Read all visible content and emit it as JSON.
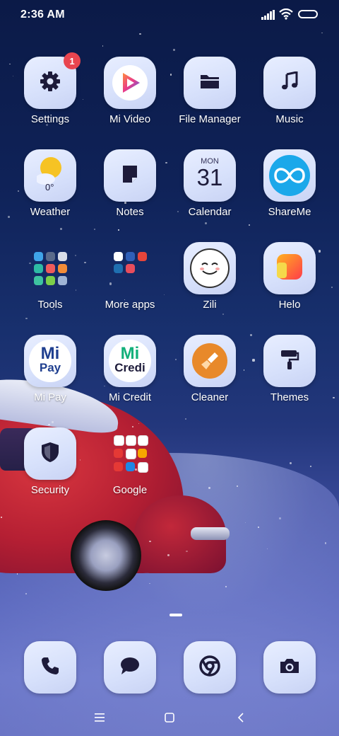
{
  "status_bar": {
    "time": "2:36 AM"
  },
  "apps": [
    {
      "label": "Settings",
      "icon": "gear-icon",
      "badge": "1"
    },
    {
      "label": "Mi Video",
      "icon": "play-icon"
    },
    {
      "label": "File Manager",
      "icon": "folder-icon"
    },
    {
      "label": "Music",
      "icon": "music-note-icon"
    },
    {
      "label": "Weather",
      "icon": "weather-icon",
      "temp": "0°"
    },
    {
      "label": "Notes",
      "icon": "note-icon"
    },
    {
      "label": "Calendar",
      "icon": "calendar-icon",
      "day_name": "MON",
      "day_number": "31"
    },
    {
      "label": "ShareMe",
      "icon": "shareme-icon"
    },
    {
      "label": "Tools",
      "icon": "folder-tools-icon"
    },
    {
      "label": "More apps",
      "icon": "folder-more-apps-icon"
    },
    {
      "label": "Zili",
      "icon": "zili-face-icon"
    },
    {
      "label": "Helo",
      "icon": "helo-icon"
    },
    {
      "label": "Mi Pay",
      "icon": "mi-pay-icon",
      "icon_text_1": "Mi",
      "icon_text_2": "Pay"
    },
    {
      "label": "Mi Credit",
      "icon": "mi-credit-icon",
      "icon_text_1": "Mi",
      "icon_text_2": "Credi"
    },
    {
      "label": "Cleaner",
      "icon": "broom-icon"
    },
    {
      "label": "Themes",
      "icon": "paint-roller-icon"
    },
    {
      "label": "Security",
      "icon": "shield-icon"
    },
    {
      "label": "Google",
      "icon": "folder-google-icon"
    }
  ],
  "dock": [
    {
      "name": "phone",
      "icon": "phone-icon"
    },
    {
      "name": "messages",
      "icon": "message-icon"
    },
    {
      "name": "browser",
      "icon": "browser-icon"
    },
    {
      "name": "camera",
      "icon": "camera-icon"
    }
  ],
  "nav": [
    "menu-icon",
    "home-icon",
    "back-icon"
  ],
  "colors": {
    "icon_glyph": "#1d1b3a",
    "badge": "#e8454f",
    "mi_pay_blue": "#1f3f8f",
    "mi_credit_green": "#12b07a",
    "cleaner_orange": "#e8892a"
  }
}
